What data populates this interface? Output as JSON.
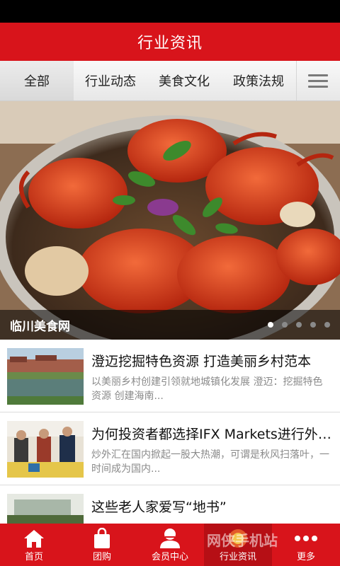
{
  "header": {
    "title": "行业资讯"
  },
  "tabs": [
    {
      "label": "全部",
      "active": true
    },
    {
      "label": "行业动态"
    },
    {
      "label": "美食文化"
    },
    {
      "label": "政策法规"
    }
  ],
  "menu_icon": "hamburger-menu-icon",
  "banner": {
    "caption": "临川美食网",
    "slide_count": 5,
    "active_slide": 1
  },
  "news": [
    {
      "title": "澄迈挖掘特色资源 打造美丽乡村范本",
      "desc": "以美丽乡村创建引领就地城镇化发展 澄迈：挖掘特色资源 创建海南..."
    },
    {
      "title": "为何投资者都选择IFX Markets进行外汇交易",
      "desc": "炒外汇在国内掀起一股大热潮，可谓是秋风扫落叶，一时间成为国内..."
    },
    {
      "title": "这些老人家爱写“地书”",
      "desc": ""
    }
  ],
  "bottom_nav": [
    {
      "label": "首页",
      "icon": "home-icon"
    },
    {
      "label": "团购",
      "icon": "shopping-bag-icon"
    },
    {
      "label": "会员中心",
      "icon": "user-icon"
    },
    {
      "label": "行业资讯",
      "icon": "news-icon",
      "active": true
    },
    {
      "label": "更多",
      "icon": "more-icon"
    }
  ],
  "watermark": "网侠手机站",
  "colors": {
    "brand_red": "#d8141b"
  }
}
